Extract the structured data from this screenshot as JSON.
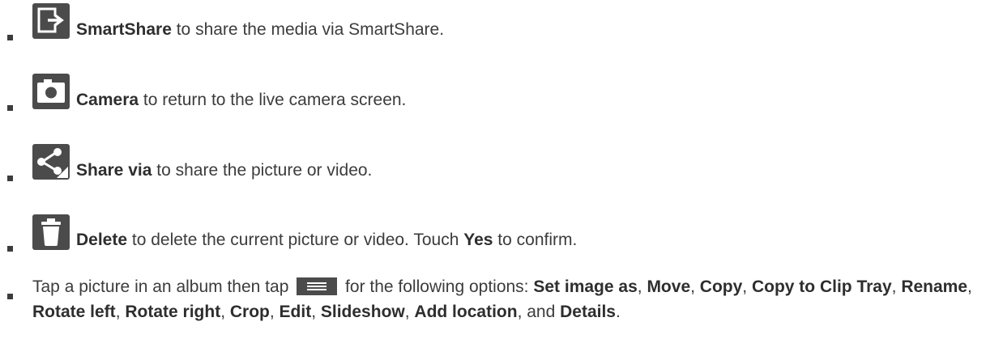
{
  "items": [
    {
      "icon": "smartshare-icon",
      "label": "SmartShare",
      "desc": " to share the media via SmartShare."
    },
    {
      "icon": "camera-icon",
      "label": "Camera",
      "desc": " to return to the live camera screen."
    },
    {
      "icon": "share-icon",
      "label": "Share via",
      "desc": " to share the picture or video."
    },
    {
      "icon": "delete-icon",
      "label": "Delete",
      "desc": " to delete the current picture or video. Touch ",
      "bold2": "Yes",
      "desc2": " to confirm."
    }
  ],
  "tip": {
    "icon": "menu-icon",
    "lead": "Tap a picture in an album then tap ",
    "after_icon": " for the following options: ",
    "options": [
      "Set image as",
      "Move",
      "Copy",
      "Copy to Clip Tray",
      "Rename",
      "Rotate left",
      "Rotate right",
      "Crop",
      "Edit",
      "Slideshow",
      "Add location",
      "Details"
    ],
    "sep": ", ",
    "conj": ", and ",
    "end": "."
  }
}
